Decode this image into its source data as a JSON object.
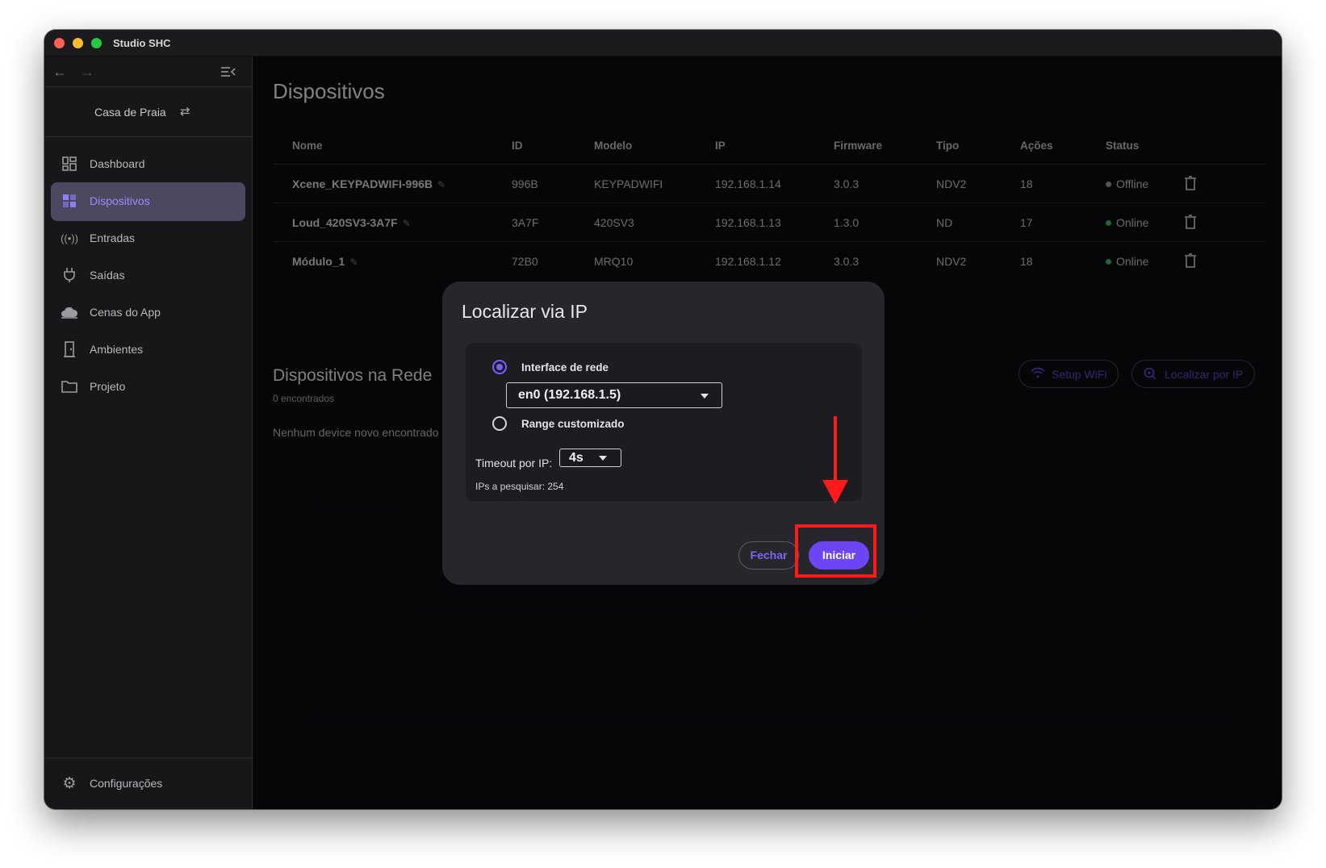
{
  "window": {
    "title": "Studio SHC"
  },
  "sidebar": {
    "home": "Casa de Praia",
    "items": [
      {
        "label": "Dashboard",
        "icon": "dashboard-icon"
      },
      {
        "label": "Dispositivos",
        "icon": "devices-icon",
        "active": true
      },
      {
        "label": "Entradas",
        "icon": "broadcast-icon"
      },
      {
        "label": "Saídas",
        "icon": "plug-icon"
      },
      {
        "label": "Cenas do App",
        "icon": "cloud-icon"
      },
      {
        "label": "Ambientes",
        "icon": "door-icon"
      },
      {
        "label": "Projeto",
        "icon": "folder-icon"
      }
    ],
    "settings": "Configurações"
  },
  "main": {
    "title": "Dispositivos",
    "table": {
      "headers": [
        "Nome",
        "ID",
        "Modelo",
        "IP",
        "Firmware",
        "Tipo",
        "Ações",
        "Status"
      ],
      "rows": [
        {
          "name": "Xcene_KEYPADWIFI-996B",
          "id": "996B",
          "model": "KEYPADWIFI",
          "ip": "192.168.1.14",
          "firmware": "3.0.3",
          "type": "NDV2",
          "actions": "18",
          "status": "Offline"
        },
        {
          "name": "Loud_420SV3-3A7F",
          "id": "3A7F",
          "model": "420SV3",
          "ip": "192.168.1.13",
          "firmware": "1.3.0",
          "type": "ND",
          "actions": "17",
          "status": "Online"
        },
        {
          "name": "Módulo_1",
          "id": "72B0",
          "model": "MRQ10",
          "ip": "192.168.1.12",
          "firmware": "3.0.3",
          "type": "NDV2",
          "actions": "18",
          "status": "Online"
        }
      ]
    },
    "network_section": {
      "title": "Dispositivos na Rede",
      "count": "0 encontrados",
      "empty": "Nenhum device novo encontrado",
      "setup_wifi": "Setup WiFi",
      "locate_ip": "Localizar por IP"
    }
  },
  "modal": {
    "title": "Localizar via IP",
    "option_interface": "Interface de rede",
    "interface_value": "en0 (192.168.1.5)",
    "option_custom": "Range customizado",
    "timeout_label": "Timeout por IP:",
    "timeout_value": "4s",
    "ips_label": "IPs a pesquisar: 254",
    "close_label": "Fechar",
    "start_label": "Iniciar"
  },
  "colors": {
    "accent": "#6d45f2",
    "online": "#2ea84a",
    "annotation": "#ff1a1a"
  }
}
